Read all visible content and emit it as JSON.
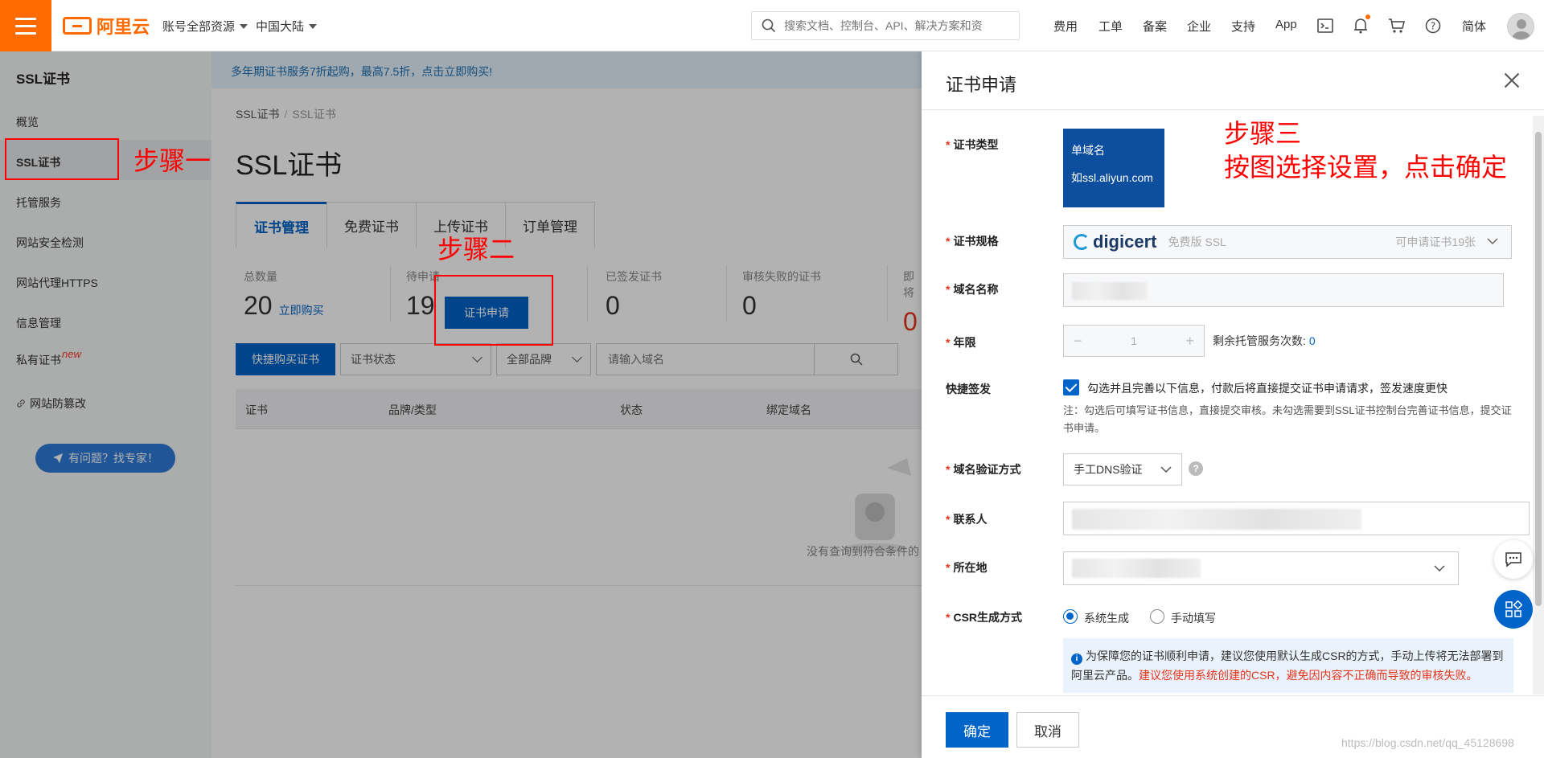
{
  "topbar": {
    "brand": "阿里云",
    "account_select": "账号全部资源",
    "region_select": "中国大陆",
    "search_placeholder": "搜索文档、控制台、API、解决方案和资",
    "nav": [
      "费用",
      "工单",
      "备案",
      "企业",
      "支持",
      "App"
    ],
    "lang": "简体",
    "icons": [
      "terminal-icon",
      "bell-icon",
      "cart-icon",
      "help-icon"
    ]
  },
  "sidebar": {
    "title": "SSL证书",
    "items": [
      {
        "label": "概览"
      },
      {
        "label": "SSL证书"
      },
      {
        "label": "托管服务"
      },
      {
        "label": "网站安全检测"
      },
      {
        "label": "网站代理HTTPS"
      },
      {
        "label": "信息管理"
      },
      {
        "label": "私有证书",
        "tag": "new"
      },
      {
        "label": "网站防篡改"
      }
    ],
    "help_button": "有问题？找专家！"
  },
  "main": {
    "banner": "多年期证书服务7折起购，最高7.5折，点击立即购买!",
    "breadcrumb": [
      "SSL证书",
      "SSL证书"
    ],
    "title": "SSL证书",
    "tabs": [
      "证书管理",
      "免费证书",
      "上传证书",
      "订单管理"
    ],
    "stats": [
      {
        "label": "总数量",
        "value": "20",
        "link": "立即购买"
      },
      {
        "label": "待申请",
        "value": "19"
      },
      {
        "label": "已签发证书",
        "value": "0"
      },
      {
        "label": "审核失败的证书",
        "value": "0"
      },
      {
        "label": "即将",
        "value": "0"
      }
    ],
    "apply_button": "证书申请",
    "buy_button": "快捷购买证书",
    "status_select": "证书状态",
    "brand_select": "全部品牌",
    "domain_placeholder": "请输入域名",
    "columns": [
      "证书",
      "品牌/类型",
      "状态",
      "绑定域名"
    ],
    "empty_text": "没有查询到符合条件的"
  },
  "drawer": {
    "title": "证书申请",
    "labels": {
      "type": "证书类型",
      "spec": "证书规格",
      "domain": "域名名称",
      "years": "年限",
      "quick": "快捷签发",
      "verify": "域名验证方式",
      "contact": "联系人",
      "location": "所在地",
      "csr": "CSR生成方式"
    },
    "type_card": {
      "title": "单域名",
      "example": "如ssl.aliyun.com"
    },
    "spec": {
      "brand": "digicert",
      "edition": "免费版 SSL",
      "remaining": "可申请证书19张"
    },
    "years_value": "1",
    "years_minus": "−",
    "years_plus": "+",
    "years_note": "剩余托管服务次数:",
    "years_note_value": "0",
    "quick_check_text": "勾选并且完善以下信息，付款后将直接提交证书申请请求，签发速度更快",
    "quick_note": "注：勾选后可填写证书信息，直接提交审核。未勾选需要到SSL证书控制台完善证书信息，提交证书申请。",
    "verify_value": "手工DNS验证",
    "csr_options": [
      "系统生成",
      "手动填写"
    ],
    "csr_info_main": "为保障您的证书顺利申请，建议您使用默认生成CSR的方式，手动上传将无法部署到阿里云产品。",
    "csr_info_red": "建议您使用系统创建的CSR，避免因内容不正确而导致的审核失败。",
    "ok": "确定",
    "cancel": "取消"
  },
  "annotations": {
    "step1": "步骤一",
    "step2": "步骤二",
    "step3_line1": "步骤三",
    "step3_line2": "按图选择设置，点击确定"
  },
  "watermark": "https://blog.csdn.net/qq_45128698",
  "colors": {
    "accent": "#ff6a00",
    "primary": "#0064c8",
    "annotation": "#ff0000"
  }
}
